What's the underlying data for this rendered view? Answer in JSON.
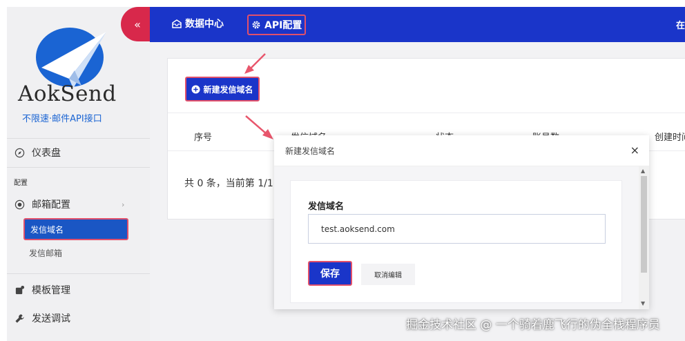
{
  "brand": {
    "name": "AokSend",
    "tagline": "不限速·邮件API接口"
  },
  "topbar": {
    "items": [
      {
        "label": "数据中心",
        "icon": "inbox-icon"
      },
      {
        "label": "API配置",
        "icon": "gear-icon"
      }
    ],
    "right_text": "在"
  },
  "sidebar": {
    "collapse_label": "«",
    "dashboard": "仪表盘",
    "section_config": "配置",
    "mail_config": "邮箱配置",
    "sub_items": [
      "发信域名",
      "发信邮箱"
    ],
    "template_mgmt": "模板管理",
    "send_test": "发送调试"
  },
  "main": {
    "add_button": "新建发信域名",
    "columns": [
      "序号",
      "发信域名",
      "状态",
      "账号数",
      "创建时间"
    ],
    "pager": "共 0 条，当前第 1/1"
  },
  "modal": {
    "title": "新建发信域名",
    "close": "×",
    "field_label": "发信域名",
    "field_value": "test.aoksend.com",
    "save_label": "保存",
    "cancel_label": "取消编辑"
  },
  "watermark": "掘金技术社区 @ 一个骑着鹿飞行的伪全栈程序员",
  "colors": {
    "primary": "#1a35c9",
    "active": "#1a56c4",
    "collapse": "#d8284b",
    "highlight": "#e2506a"
  }
}
